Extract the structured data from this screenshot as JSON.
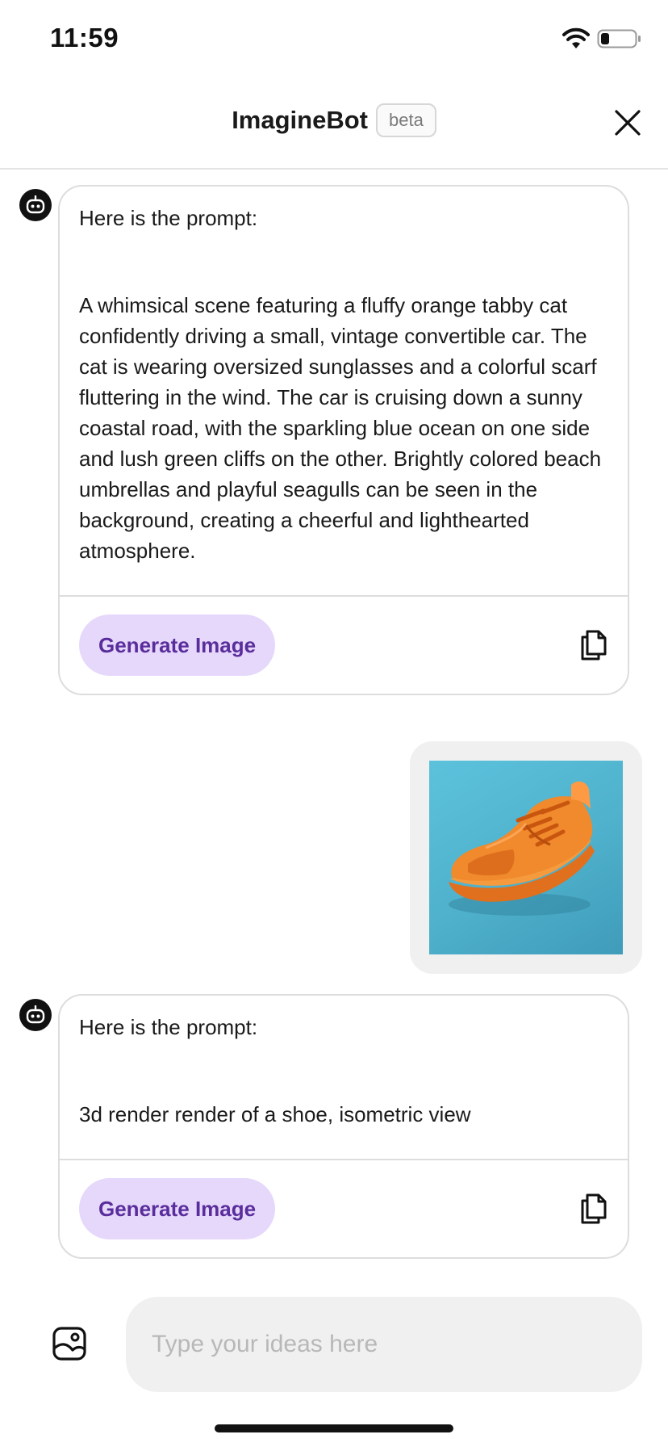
{
  "status_bar": {
    "time": "11:59",
    "icons": [
      "wifi-icon",
      "battery-icon"
    ]
  },
  "header": {
    "title": "ImagineBot",
    "badge": "beta",
    "close_icon": "close-icon"
  },
  "messages": [
    {
      "sender": "bot",
      "intro": "Here is the prompt:",
      "prompt": "A whimsical scene featuring a fluffy orange tabby cat confidently driving a small, vintage convertible car. The cat is wearing oversized sunglasses and a colorful scarf fluttering in the wind. The car is cruising down a sunny coastal road, with the sparkling blue ocean on one side and lush green cliffs on the other. Brightly colored beach umbrellas and playful seagulls can be seen in the background, creating a cheerful and lighthearted atmosphere.",
      "action_label": "Generate Image",
      "copy_icon": "copy-icon"
    },
    {
      "sender": "user",
      "image": "orange-sneaker-on-blue-background"
    },
    {
      "sender": "bot",
      "intro": "Here is the prompt:",
      "prompt": "3d render render of a shoe, isometric view",
      "action_label": "Generate Image",
      "copy_icon": "copy-icon"
    }
  ],
  "composer": {
    "placeholder": "Type your ideas here",
    "value": "",
    "attach_icon": "image-icon"
  },
  "colors": {
    "accent_bg": "#e6d8fb",
    "accent_text": "#5a2d9c",
    "image_bg": "#4fb1cc",
    "shoe": "#f08a2c"
  }
}
